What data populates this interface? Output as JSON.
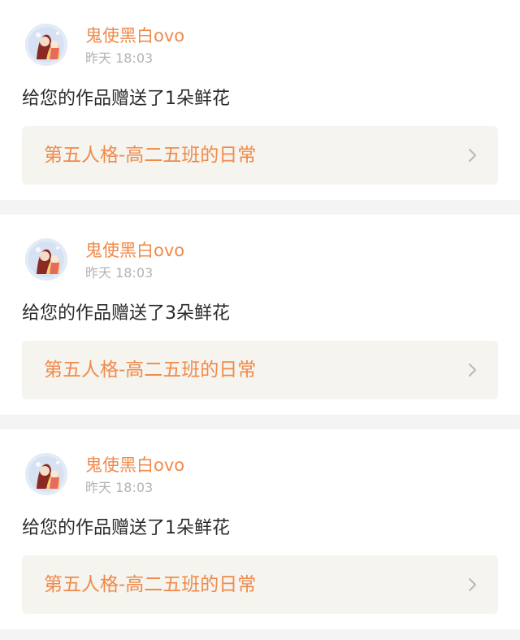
{
  "notifications": [
    {
      "username": "鬼使黑白ovo",
      "time": "昨天 18:03",
      "message": "给您的作品赠送了1朵鲜花",
      "work_title": "第五人格-高二五班的日常"
    },
    {
      "username": "鬼使黑白ovo",
      "time": "昨天 18:03",
      "message": "给您的作品赠送了3朵鲜花",
      "work_title": "第五人格-高二五班的日常"
    },
    {
      "username": "鬼使黑白ovo",
      "time": "昨天 18:03",
      "message": "给您的作品赠送了1朵鲜花",
      "work_title": "第五人格-高二五班的日常"
    }
  ],
  "icons": {
    "avatar": "user-avatar",
    "link_arrow": "chevron-right-icon"
  },
  "colors": {
    "username": "#f08a4b",
    "work_title": "#f08a4b",
    "timestamp": "#b3b3b3",
    "message": "#2b2b2b",
    "link_background": "#f5f4ee",
    "page_background": "#f4f4f4"
  }
}
